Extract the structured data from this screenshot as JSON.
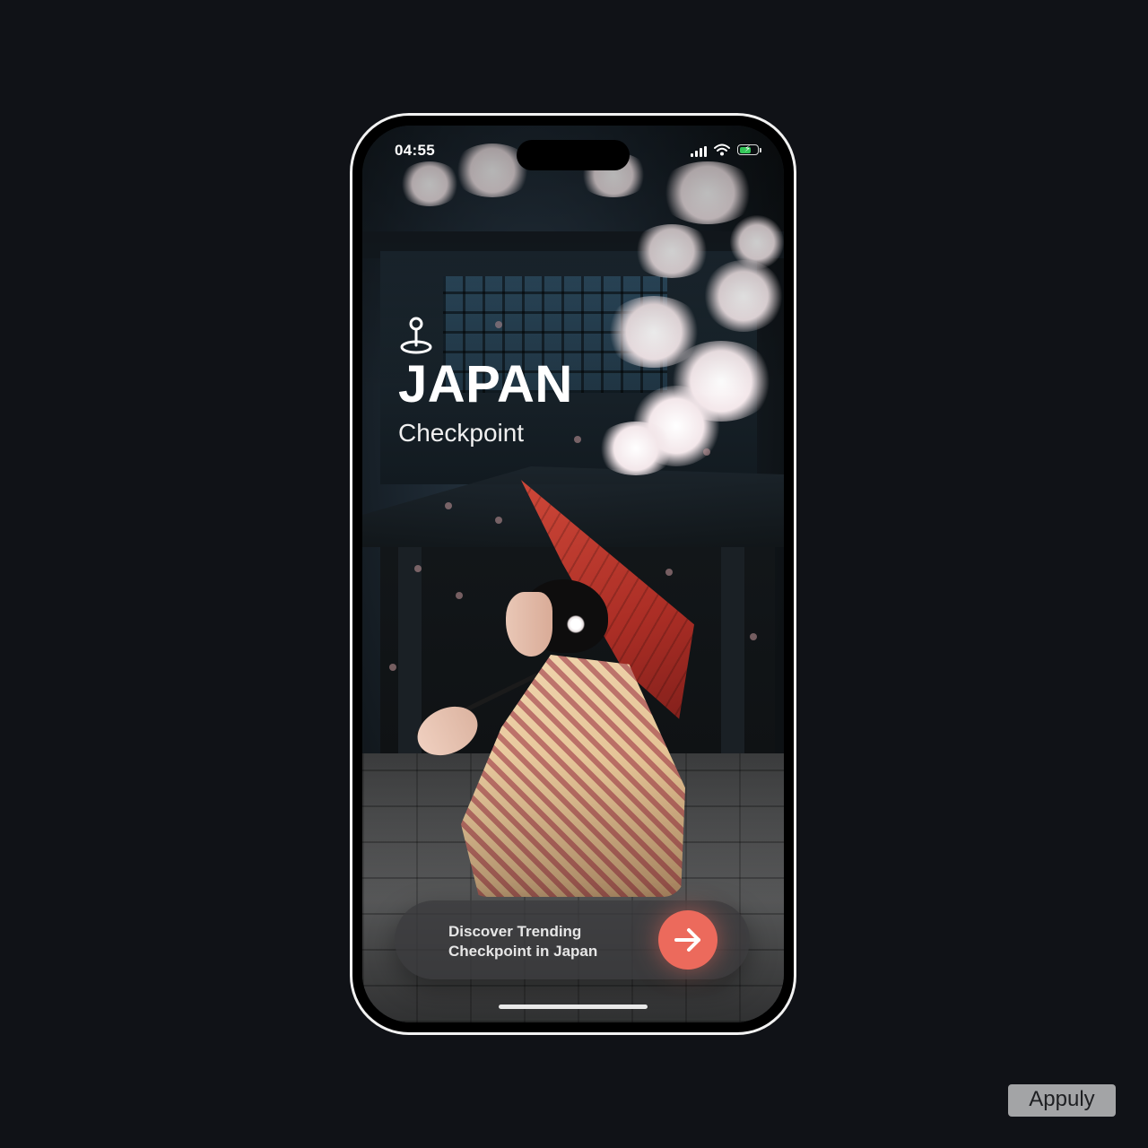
{
  "status_bar": {
    "time": "04:55",
    "battery_color": "#34c759",
    "battery_level": 0.7,
    "icons": [
      "signal-icon",
      "wifi-icon",
      "battery-charging-icon"
    ]
  },
  "hero": {
    "icon": "location-pin-icon",
    "title": "JAPAN",
    "subtitle": "Checkpoint"
  },
  "cta": {
    "line1": "Discover Trending",
    "line2": "Checkpoint in Japan",
    "button_icon": "arrow-right-icon",
    "accent_color": "#ec6a5c"
  },
  "watermark": {
    "text": "Appuly"
  },
  "colors": {
    "page_background": "#101217",
    "phone_frame": "#f2f2f2"
  }
}
